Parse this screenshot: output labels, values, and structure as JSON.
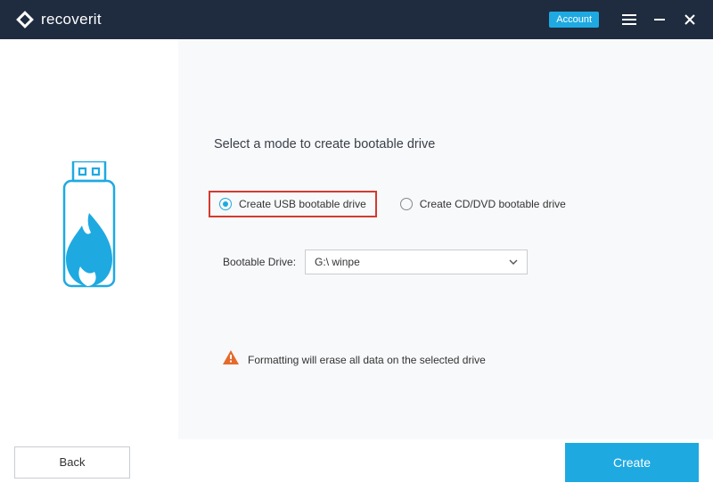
{
  "titlebar": {
    "brand": "recoverit",
    "account_label": "Account"
  },
  "main": {
    "heading": "Select a mode to create bootable drive",
    "option_usb": "Create USB bootable drive",
    "option_cddvd": "Create CD/DVD bootable drive",
    "drive_label": "Bootable Drive:",
    "drive_selected": "G:\\ winpe",
    "warning": "Formatting will erase all data on the selected drive"
  },
  "footer": {
    "back_label": "Back",
    "create_label": "Create"
  },
  "colors": {
    "accent": "#1fa9e1",
    "titlebar_bg": "#1f2b3f",
    "highlight_border": "#d33b2f",
    "warning_icon": "#e66a2a"
  }
}
